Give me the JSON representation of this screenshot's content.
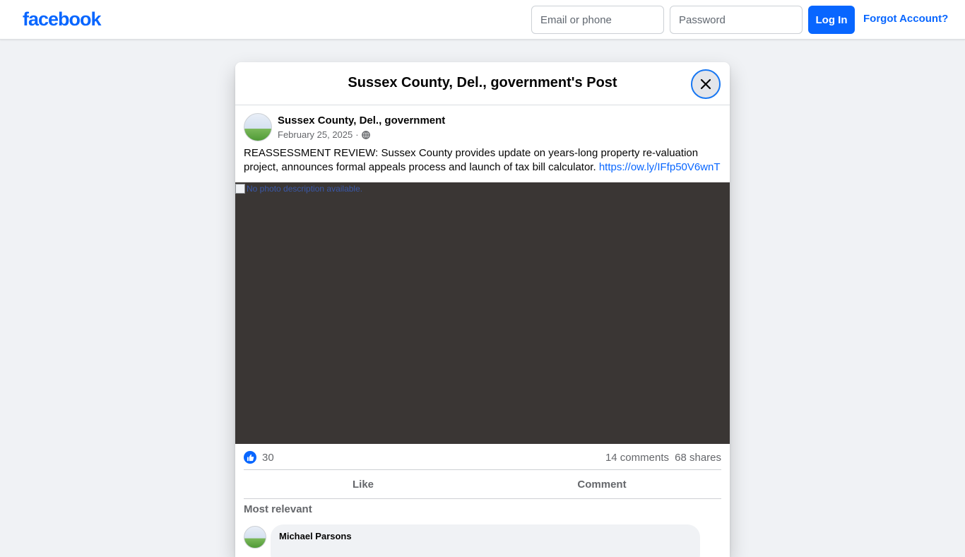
{
  "brand": {
    "logo_text": "facebook",
    "accent_color": "#0866ff"
  },
  "login": {
    "email_placeholder": "Email or phone",
    "password_placeholder": "Password",
    "login_label": "Log In",
    "forgot_label": "Forgot Account?"
  },
  "dialog": {
    "title": "Sussex County, Del., government's Post",
    "close_icon": "close-icon"
  },
  "post": {
    "author": "Sussex County, Del., government",
    "date": "February 25, 2025",
    "separator": "·",
    "audience_icon": "globe-icon",
    "text": "REASSESSMENT REVIEW: Sussex County provides update on years-long property re-valuation project, announces formal appeals process and launch of tax bill calculator.",
    "link": "https://ow.ly/IFfp50V6wnT",
    "image_alt": "No photo description available."
  },
  "stats": {
    "reaction_icon": "like-reaction-icon",
    "likes": "30",
    "comments": "14 comments",
    "shares": "68 shares"
  },
  "actions": {
    "like_label": "Like",
    "comment_label": "Comment"
  },
  "comments_section": {
    "filter_label": "Most relevant",
    "items": [
      {
        "author": "Michael Parsons"
      }
    ]
  }
}
